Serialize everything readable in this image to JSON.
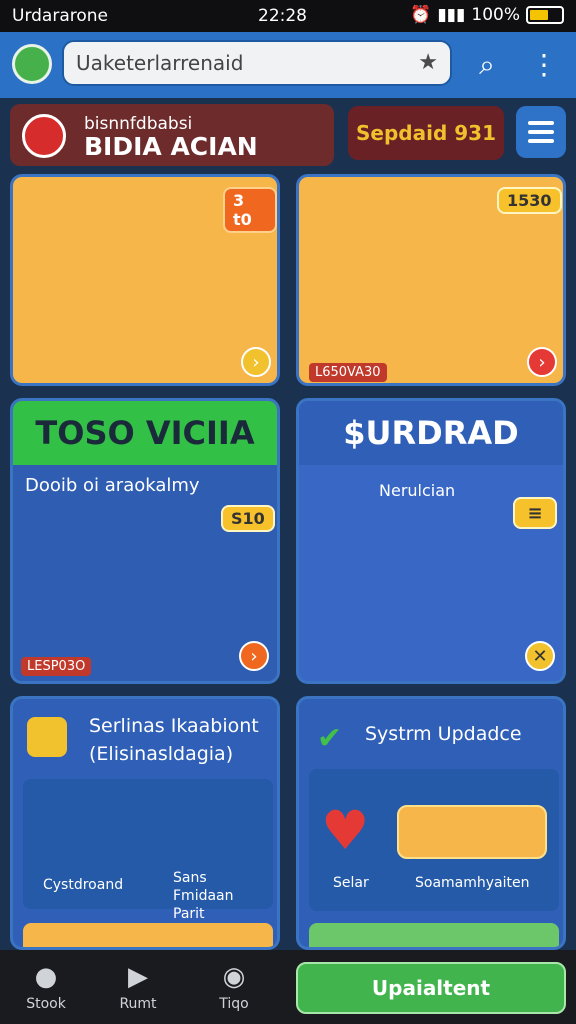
{
  "status_bar": {
    "carrier": "Urdararone",
    "time": "22:28",
    "battery": "100%",
    "battery_level": 0.6
  },
  "app_bar": {
    "url_text": "Uaketerlarrenaid",
    "star_icon": "star-icon",
    "search_icon": "search-icon",
    "more_icon": "more-vert-icon",
    "accent": "#2b72c6"
  },
  "header": {
    "brand_line1": "bisnnfdbabsi",
    "brand_line2": "BIDIA ACIAN",
    "promo": "Sepdaid 931",
    "menu_icon": "hamburger-menu-icon"
  },
  "cards": [
    {
      "price": "3 t0",
      "chip": "",
      "btn_icon": "coin-icon"
    },
    {
      "price": "1530",
      "chip": "L650VA30",
      "btn_icon": "arrow-right-icon"
    },
    {
      "title": "TOSO VICIIA",
      "subtitle": "Dooib oi araokalmy",
      "price": "S10",
      "chip": "LESP03O",
      "btn_icon": "arrow-right-icon"
    },
    {
      "title": "$URDRAD",
      "subtitle": "Nerulcian",
      "badge_icon": "chat-icon",
      "btn_icon": "close-icon"
    }
  ],
  "section_left": {
    "title": "Serlinas Ikaabiont",
    "subtitle": "(Elisinasldagia)",
    "items": [
      {
        "label": "Cystdroand"
      },
      {
        "label": "Sans Fmidaan Parit Baogade"
      }
    ]
  },
  "section_right": {
    "title": "Systrm Updadce",
    "items": [
      {
        "label": "Selar"
      },
      {
        "label": "Soamamhyaiten"
      }
    ]
  },
  "bottom_nav": {
    "items": [
      {
        "label": "Stook",
        "icon": "shop-icon"
      },
      {
        "label": "Rumt",
        "icon": "play-icon"
      },
      {
        "label": "Tiqo",
        "icon": "cat-icon"
      }
    ],
    "update_label": "Upaialtent"
  }
}
